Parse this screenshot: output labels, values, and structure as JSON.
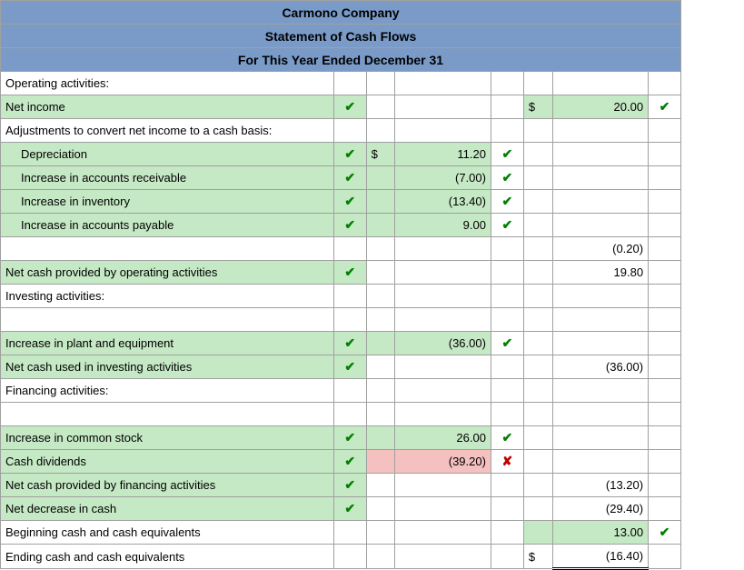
{
  "header": {
    "company": "Carmono Company",
    "statement": "Statement of Cash Flows",
    "period": "For This Year Ended December 31"
  },
  "rows": [
    {
      "label": "Operating activities:",
      "labelCls": "",
      "labelMark": "",
      "d1": "",
      "v1": "",
      "m1": "",
      "d2": "",
      "v2": "",
      "m2": ""
    },
    {
      "label": "Net income",
      "labelCls": "green-bg",
      "labelMark": "check",
      "d1": "",
      "v1": "",
      "m1": "",
      "d2": "$",
      "d2Cls": "green-bg",
      "v2": "20.00",
      "v2Cls": "green-bg",
      "m2": "check"
    },
    {
      "label": "Adjustments to convert net income to a cash basis:",
      "labelCls": "",
      "labelMark": "",
      "d1": "",
      "v1": "",
      "m1": "",
      "d2": "",
      "v2": "",
      "m2": ""
    },
    {
      "label": "Depreciation",
      "indent": true,
      "labelCls": "green-bg",
      "labelMark": "check",
      "d1": "$",
      "d1Cls": "green-bg",
      "v1": "11.20",
      "v1Cls": "green-bg",
      "m1": "check",
      "d2": "",
      "v2": "",
      "m2": ""
    },
    {
      "label": "Increase in accounts receivable",
      "indent": true,
      "labelCls": "green-bg",
      "labelMark": "check",
      "d1": "",
      "d1Cls": "green-bg",
      "v1": "(7.00)",
      "v1Cls": "green-bg",
      "m1": "check",
      "d2": "",
      "v2": "",
      "m2": ""
    },
    {
      "label": "Increase in inventory",
      "indent": true,
      "labelCls": "green-bg",
      "labelMark": "check",
      "d1": "",
      "d1Cls": "green-bg",
      "v1": "(13.40)",
      "v1Cls": "green-bg",
      "m1": "check",
      "d2": "",
      "v2": "",
      "m2": ""
    },
    {
      "label": "Increase in accounts payable",
      "indent": true,
      "labelCls": "green-bg",
      "labelMark": "check",
      "d1": "",
      "d1Cls": "green-bg",
      "v1": "9.00",
      "v1Cls": "green-bg",
      "m1": "check",
      "d2": "",
      "v2": "",
      "m2": ""
    },
    {
      "label": "",
      "labelCls": "",
      "labelMark": "",
      "d1": "",
      "v1": "",
      "v1TopBorder": true,
      "m1": "",
      "d2": "",
      "v2": "(0.20)",
      "m2": ""
    },
    {
      "label": "Net cash provided by operating activities",
      "labelCls": "green-bg",
      "labelMark": "check",
      "d1": "",
      "v1": "",
      "m1": "",
      "d2": "",
      "v2": "19.80",
      "v2TopBorder": true,
      "m2": ""
    },
    {
      "label": "Investing activities:",
      "labelCls": "",
      "labelMark": "",
      "d1": "",
      "v1": "",
      "m1": "",
      "d2": "",
      "v2": "",
      "m2": ""
    },
    {
      "label": "",
      "labelCls": "",
      "labelMark": "",
      "d1": "",
      "v1": "",
      "m1": "",
      "d2": "",
      "v2": "",
      "m2": ""
    },
    {
      "label": "Increase in plant and equipment",
      "labelCls": "green-bg",
      "labelMark": "check",
      "d1": "",
      "d1Cls": "green-bg",
      "v1": "(36.00)",
      "v1Cls": "green-bg",
      "m1": "check",
      "d2": "",
      "v2": "",
      "m2": ""
    },
    {
      "label": "Net cash used in investing activities",
      "labelCls": "green-bg",
      "labelMark": "check",
      "d1": "",
      "v1": "",
      "v1TopBorder": true,
      "m1": "",
      "d2": "",
      "v2": "(36.00)",
      "m2": ""
    },
    {
      "label": "Financing activities:",
      "labelCls": "",
      "labelMark": "",
      "d1": "",
      "v1": "",
      "m1": "",
      "d2": "",
      "v2": "",
      "m2": ""
    },
    {
      "label": "",
      "labelCls": "",
      "labelMark": "",
      "d1": "",
      "v1": "",
      "m1": "",
      "d2": "",
      "v2": "",
      "m2": ""
    },
    {
      "label": "Increase in common stock",
      "labelCls": "green-bg",
      "labelMark": "check",
      "d1": "",
      "d1Cls": "green-bg",
      "v1": "26.00",
      "v1Cls": "green-bg",
      "m1": "check",
      "d2": "",
      "v2": "",
      "m2": ""
    },
    {
      "label": "Cash dividends",
      "labelCls": "green-bg",
      "labelMark": "check",
      "d1": "",
      "d1Cls": "pink-bg",
      "v1": "(39.20)",
      "v1Cls": "pink-bg",
      "m1": "cross",
      "d2": "",
      "v2": "",
      "m2": ""
    },
    {
      "label": "Net cash provided by financing activities",
      "labelCls": "green-bg",
      "labelMark": "check",
      "d1": "",
      "v1": "",
      "v1TopBorder": true,
      "m1": "",
      "d2": "",
      "v2": "(13.20)",
      "m2": ""
    },
    {
      "label": "Net decrease in cash",
      "labelCls": "green-bg",
      "labelMark": "check",
      "d1": "",
      "v1": "",
      "m1": "",
      "d2": "",
      "v2": "(29.40)",
      "v2TopBorder": true,
      "m2": ""
    },
    {
      "label": "Beginning cash and cash equivalents",
      "labelCls": "",
      "labelMark": "",
      "d1": "",
      "v1": "",
      "m1": "",
      "d2": "",
      "d2Cls": "green-bg",
      "v2": "13.00",
      "v2Cls": "green-bg",
      "m2": "check"
    },
    {
      "label": "Ending cash and cash equivalents",
      "labelCls": "",
      "labelMark": "",
      "d1": "",
      "v1": "",
      "m1": "",
      "d2": "$",
      "v2": "(16.40)",
      "v2TopBorder": true,
      "v2DoubleBottom": true,
      "m2": ""
    }
  ]
}
